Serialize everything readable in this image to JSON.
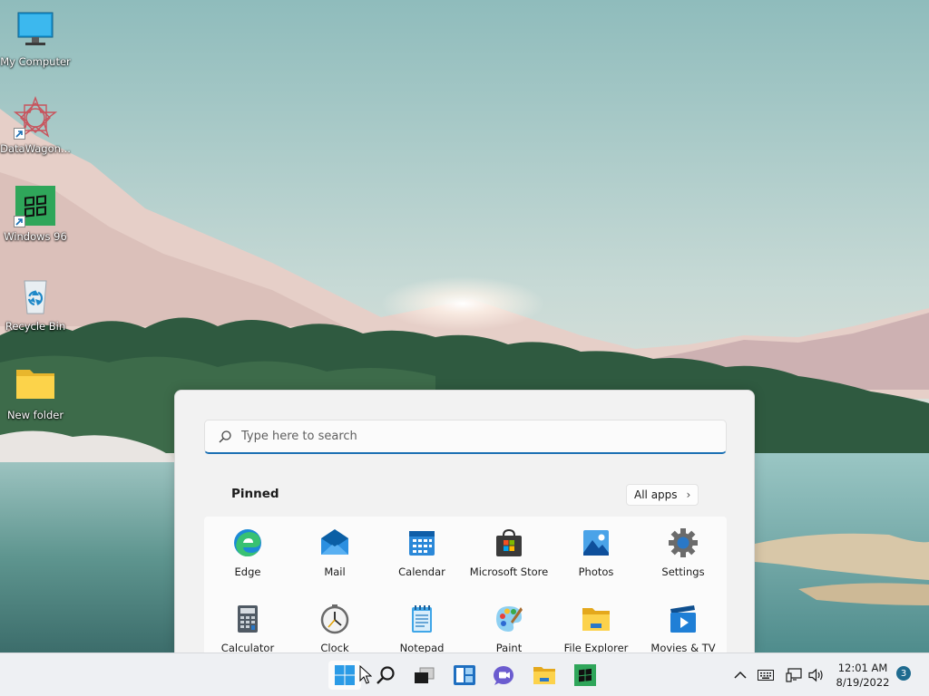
{
  "desktop": {
    "icons": [
      {
        "label": "My Computer"
      },
      {
        "label": "DataWagon..."
      },
      {
        "label": "Windows 96"
      },
      {
        "label": "Recycle Bin"
      },
      {
        "label": "New folder"
      }
    ]
  },
  "start_menu": {
    "search": {
      "placeholder": "Type here to search"
    },
    "pinned_title": "Pinned",
    "all_apps_label": "All apps",
    "apps": [
      {
        "label": "Edge",
        "icon": "edge-icon"
      },
      {
        "label": "Mail",
        "icon": "mail-icon"
      },
      {
        "label": "Calendar",
        "icon": "calendar-icon"
      },
      {
        "label": "Microsoft Store",
        "icon": "store-icon"
      },
      {
        "label": "Photos",
        "icon": "photos-icon"
      },
      {
        "label": "Settings",
        "icon": "gear-icon"
      },
      {
        "label": "Calculator",
        "icon": "calculator-icon"
      },
      {
        "label": "Clock",
        "icon": "clock-icon"
      },
      {
        "label": "Notepad",
        "icon": "notepad-icon"
      },
      {
        "label": "Paint",
        "icon": "paint-palette-icon"
      },
      {
        "label": "File Explorer",
        "icon": "folder-icon"
      },
      {
        "label": "Movies & TV",
        "icon": "movies-icon"
      }
    ]
  },
  "taskbar": {
    "apps": [
      "start-icon",
      "search-icon",
      "task-view-icon",
      "widgets-icon",
      "teams-chat-icon",
      "file-explorer-icon",
      "windows96-icon"
    ],
    "tray": {
      "time": "12:01 AM",
      "date": "8/19/2022",
      "notification_count": "3"
    }
  },
  "colors": {
    "accent": "#1a6fb3",
    "windows_blue": "#2b9be6",
    "badge": "#1f6b8f"
  }
}
